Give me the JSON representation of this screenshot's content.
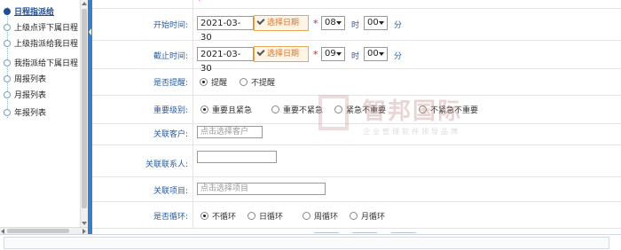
{
  "sidebar": {
    "items": [
      {
        "label": "日程指派给",
        "active": true
      },
      {
        "label": "上级点评下属日程"
      },
      {
        "label": "上级指派给我日程"
      },
      {
        "label": "我指派给下属日程"
      },
      {
        "label": "周报列表"
      },
      {
        "label": "月报列表"
      },
      {
        "label": "年报列表"
      }
    ]
  },
  "form": {
    "start_time": {
      "label": "开始时间:",
      "date": "2021-03-30",
      "date_button": "选择日期",
      "hour": "08",
      "minute": "00",
      "hour_unit": "时",
      "minute_unit": "分"
    },
    "end_time": {
      "label": "截止时间:",
      "date": "2021-03-30",
      "date_button": "选择日期",
      "hour": "09",
      "minute": "00",
      "hour_unit": "时",
      "minute_unit": "分"
    },
    "remind": {
      "label": "是否提醒:",
      "options": [
        "提醒",
        "不提醒"
      ],
      "selected": 0
    },
    "priority": {
      "label": "重要级别:",
      "options": [
        "重要且紧急",
        "重要不紧急",
        "紧急不重要",
        "不紧急不重要"
      ],
      "selected": 0
    },
    "customer": {
      "label": "关联客户:",
      "placeholder": "点击选择客户"
    },
    "contact": {
      "label": "关联联系人:",
      "value": ""
    },
    "project": {
      "label": "关联项目:",
      "placeholder": "点击选择项目"
    },
    "repeat": {
      "label": "是否循环:",
      "options": [
        "不循环",
        "日循环",
        "周循环",
        "月循环"
      ],
      "selected": 0
    }
  },
  "required_mark": "*",
  "watermark": {
    "title": "智邦国际",
    "subtitle": "企业管理软件领导品牌"
  },
  "colors": {
    "accent": "#3a7dc9",
    "label": "#2b5a9e",
    "date_button": "#e0701e",
    "required": "#e02020"
  }
}
